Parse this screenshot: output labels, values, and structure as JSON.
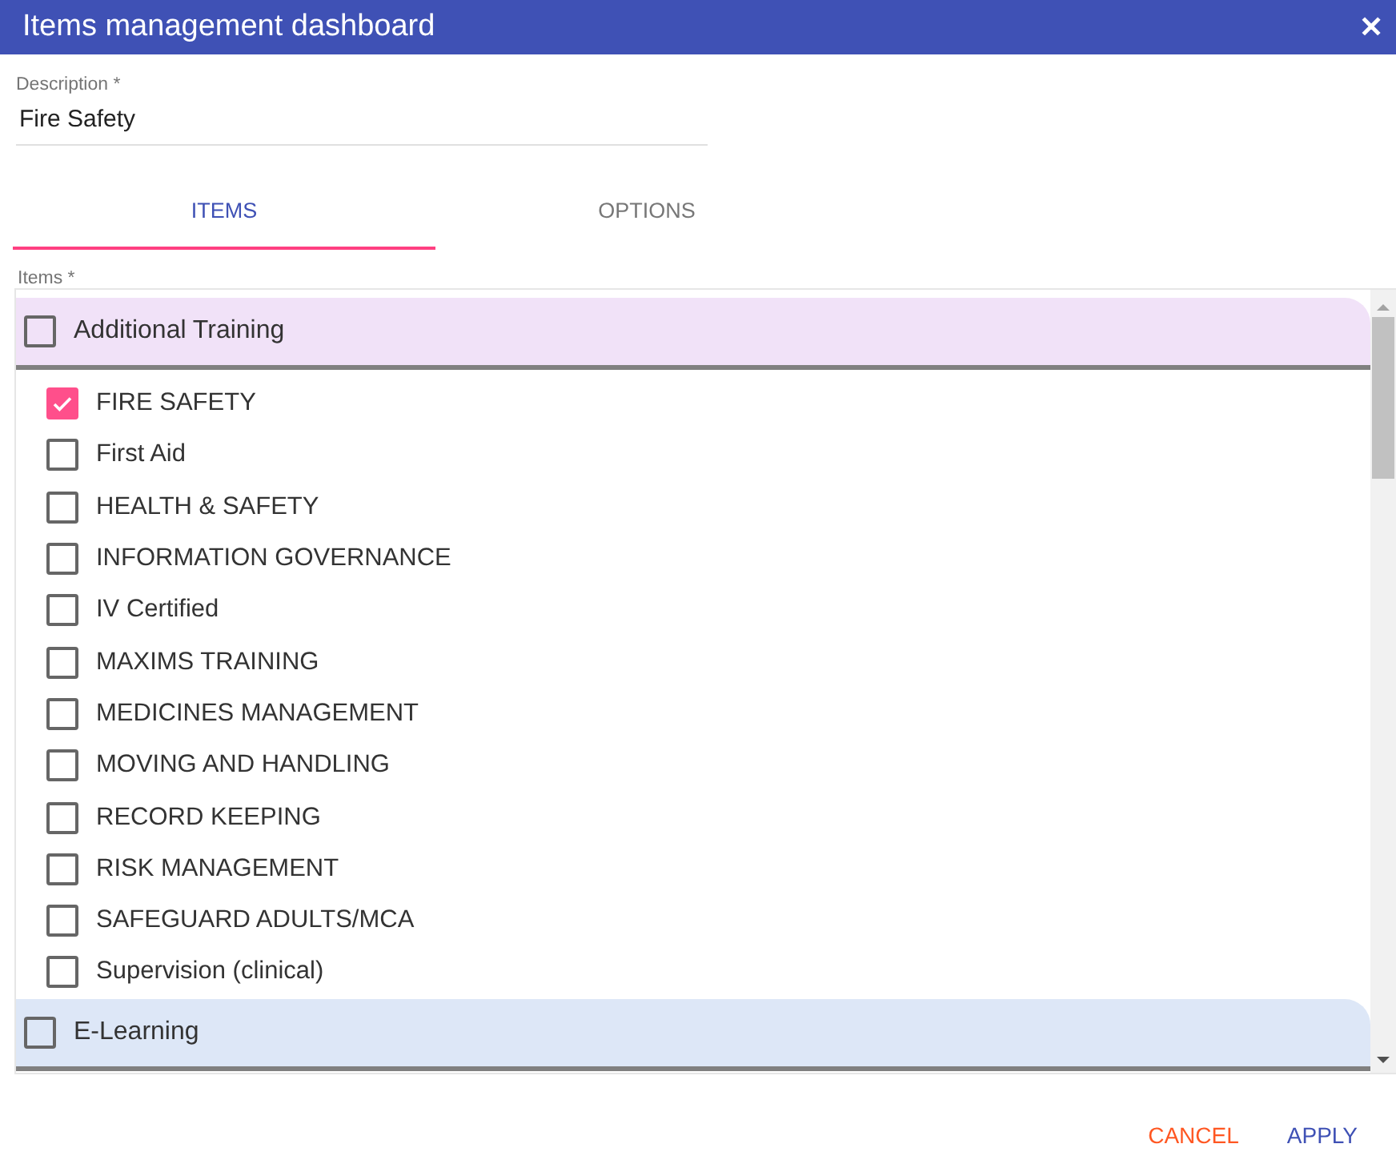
{
  "window": {
    "title": "Items management dashboard",
    "close_icon": "✕"
  },
  "description": {
    "label": "Description *",
    "value": "Fire Safety"
  },
  "tabs": [
    {
      "label": "ITEMS",
      "selected": true
    },
    {
      "label": "OPTIONS",
      "selected": false
    }
  ],
  "items_field": {
    "label": "Items *"
  },
  "groups": [
    {
      "label": "Additional Training",
      "checked": false,
      "color": "#f1e2f8",
      "children": [
        {
          "label": "FIRE SAFETY",
          "checked": true
        },
        {
          "label": "First Aid",
          "checked": false
        },
        {
          "label": "HEALTH & SAFETY",
          "checked": false
        },
        {
          "label": "INFORMATION GOVERNANCE",
          "checked": false
        },
        {
          "label": "IV Certified",
          "checked": false
        },
        {
          "label": "MAXIMS TRAINING",
          "checked": false
        },
        {
          "label": "MEDICINES MANAGEMENT",
          "checked": false
        },
        {
          "label": "MOVING AND HANDLING",
          "checked": false
        },
        {
          "label": "RECORD KEEPING",
          "checked": false
        },
        {
          "label": "RISK MANAGEMENT",
          "checked": false
        },
        {
          "label": "SAFEGUARD ADULTS/MCA",
          "checked": false
        },
        {
          "label": "Supervision (clinical)",
          "checked": false
        }
      ]
    },
    {
      "label": "E-Learning",
      "checked": false,
      "color": "#dde7f7"
    }
  ],
  "actions": [
    {
      "label": "CANCEL",
      "kind": "cancel"
    },
    {
      "label": "APPLY",
      "kind": "apply"
    }
  ]
}
